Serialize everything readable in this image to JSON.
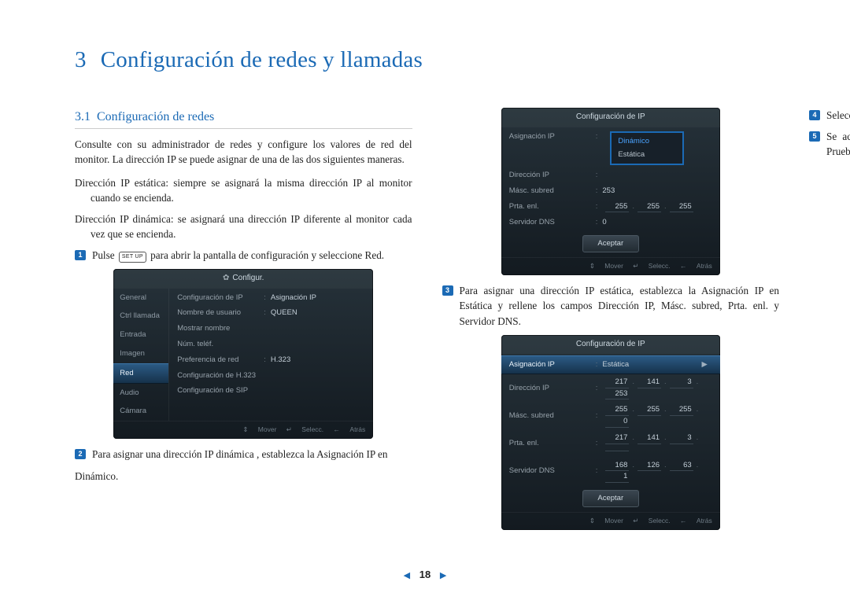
{
  "chapter": {
    "num": "3",
    "title": "Configuración de redes y llamadas"
  },
  "section": {
    "num": "3.1",
    "title": "Configuración de redes"
  },
  "para_intro": "Consulte con su administrador de redes y configure los valores de red del monitor. La dirección IP se puede asignar de una de las dos siguientes maneras.",
  "def_static": "Dirección IP estática:  siempre se asignará la misma dirección IP al monitor cuando se encienda.",
  "def_dynamic": "Dirección IP dinámica:  se asignará una dirección IP diferente al monitor cada vez que se encienda.",
  "step1_a": "Pulse ",
  "step1_key": "SET UP",
  "step1_b": " para abrir la pantalla de configuración y seleccione Red.",
  "step2": "Para asignar una dirección IP dinámica , establezca la Asignación IP en",
  "step2_cont": "Dinámico.",
  "step3": "Para asignar una dirección IP estática, establezca la Asignación IP en Estática y rellene los campos Dirección IP, Másc. subred, Prta. enl. y Servidor DNS.",
  "step4": "Seleccione Aceptar para guardar la nueva configuración.",
  "step5": "Se aconseja que compruebe que los valores IP son válidos; seleccione Prueba de red. Mientras se realiza la prueba, los elementos válidos apa-",
  "page_number": "18",
  "shot1": {
    "title": "Configur.",
    "sidebar": [
      "General",
      "Ctrl llamada",
      "Entrada",
      "Imagen",
      "Red",
      "Audio",
      "Cámara"
    ],
    "sidebar_selected": 4,
    "rows": [
      {
        "lbl": "Configuración de IP",
        "val": "Asignación IP"
      },
      {
        "lbl": "Nombre de usuario",
        "val": "QUEEN"
      },
      {
        "lbl": "Mostrar nombre",
        "val": ""
      },
      {
        "lbl": "Núm. teléf.",
        "val": ""
      },
      {
        "lbl": "Preferencia de red",
        "val": "H.323"
      },
      {
        "lbl": "Configuración de H.323",
        "val": ""
      },
      {
        "lbl": "Configuración de SIP",
        "val": ""
      }
    ],
    "foot": {
      "move": "Mover",
      "select": "Selecc.",
      "back": "Atrás"
    }
  },
  "shot2": {
    "title": "Configuración de IP",
    "rows": {
      "assign": {
        "lbl": "Asignación IP"
      },
      "dir": {
        "lbl": "Dirección IP"
      },
      "mask": {
        "lbl": "Másc. subred",
        "val": "253"
      },
      "gw": {
        "lbl": "Prta. enl.",
        "vals": [
          "255",
          "255",
          "255",
          ""
        ]
      },
      "dns": {
        "lbl": "Servidor DNS",
        "val": "0"
      }
    },
    "dropdown": [
      "Dinámico",
      "Estática"
    ],
    "accept": "Aceptar",
    "foot": {
      "move": "Mover",
      "select": "Selecc.",
      "back": "Atrás"
    }
  },
  "shot3": {
    "title": "Configuración de IP",
    "rows": {
      "assign": {
        "lbl": "Asignación IP",
        "val": "Estática"
      },
      "dir": {
        "lbl": "Dirección IP",
        "vals": [
          "217",
          "141",
          "3",
          "253"
        ]
      },
      "mask": {
        "lbl": "Másc. subred",
        "vals": [
          "255",
          "255",
          "255",
          "0"
        ]
      },
      "gw": {
        "lbl": "Prta. enl.",
        "vals": [
          "217",
          "141",
          "3",
          ""
        ]
      },
      "dns": {
        "lbl": "Servidor DNS",
        "vals": [
          "168",
          "126",
          "63",
          "1"
        ]
      }
    },
    "accept": "Aceptar",
    "foot": {
      "move": "Mover",
      "select": "Selecc.",
      "back": "Atrás"
    }
  }
}
